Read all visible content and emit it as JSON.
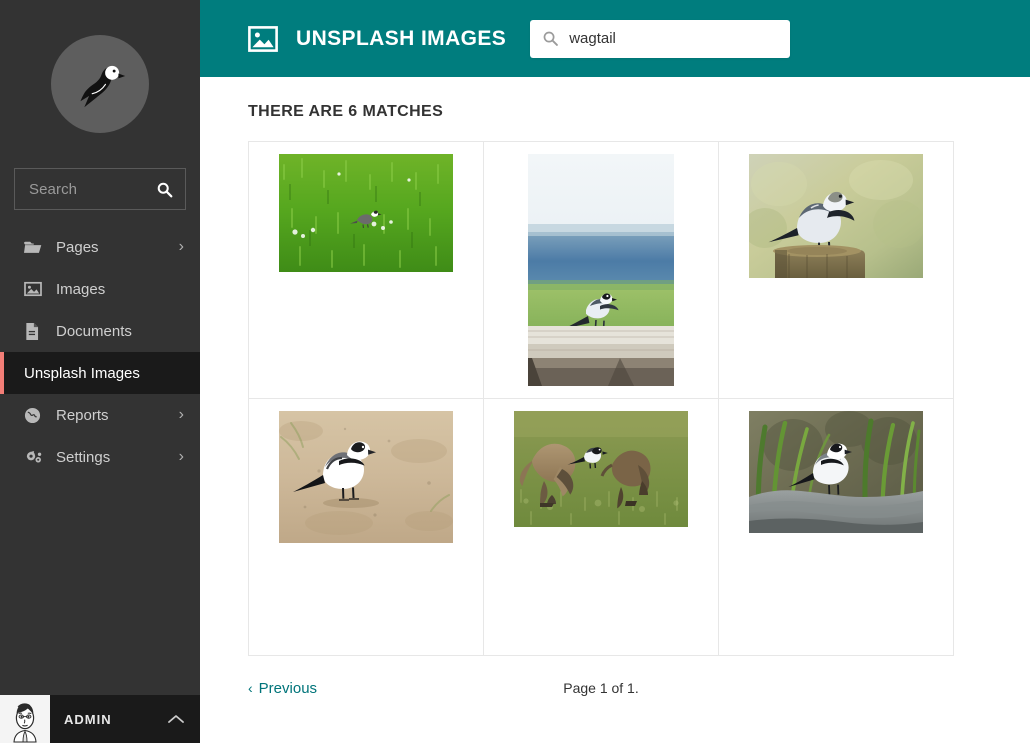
{
  "sidebar": {
    "logo_icon": "wagtail-bird-logo",
    "search": {
      "placeholder": "Search",
      "value": "",
      "icon": "search-icon"
    },
    "items": [
      {
        "label": "Pages",
        "icon": "folder-icon",
        "has_submenu": true,
        "active": false
      },
      {
        "label": "Images",
        "icon": "image-icon",
        "has_submenu": false,
        "active": false
      },
      {
        "label": "Documents",
        "icon": "document-icon",
        "has_submenu": false,
        "active": false
      },
      {
        "label": "Unsplash Images",
        "icon": "",
        "has_submenu": false,
        "active": true
      },
      {
        "label": "Reports",
        "icon": "globe-icon",
        "has_submenu": true,
        "active": false
      },
      {
        "label": "Settings",
        "icon": "gears-icon",
        "has_submenu": true,
        "active": false
      }
    ],
    "account": {
      "name": "ADMIN",
      "avatar_icon": "user-avatar",
      "arrow_icon": "chevron-up-icon"
    },
    "active_accent_color": "#f37e77",
    "background_color": "#333333"
  },
  "header": {
    "icon": "picture-icon",
    "title": "UNSPLASH IMAGES",
    "background_color": "#007d7e",
    "search": {
      "value": "wagtail",
      "placeholder": "Search",
      "icon": "search-icon"
    }
  },
  "results": {
    "heading": "THERE ARE 6 MATCHES",
    "match_count": 6,
    "items": [
      {
        "alt": "wagtail bird standing in bright green grass field"
      },
      {
        "alt": "wagtail bird perched on wooden plank with blue sea and sky behind"
      },
      {
        "alt": "white wagtail standing on top of a weathered wooden post"
      },
      {
        "alt": "pied wagtail walking on sandy dirt ground"
      },
      {
        "alt": "two kangaroos grazing in grass with a small wagtail bird between them"
      },
      {
        "alt": "white wagtail standing on a rock beside tall green reeds"
      }
    ]
  },
  "pagination": {
    "previous_label": "Previous",
    "previous_icon": "chevron-left-icon",
    "page_info": "Page 1 of 1.",
    "link_color": "#00747a"
  }
}
